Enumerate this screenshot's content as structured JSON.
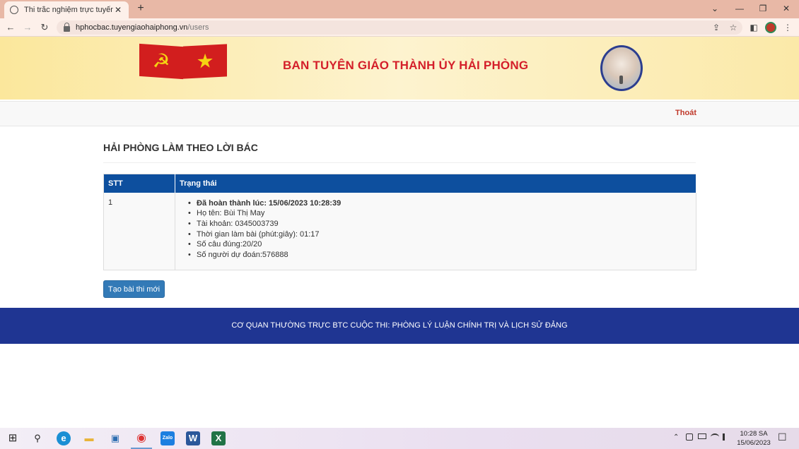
{
  "browser": {
    "tab_title": "Thi trắc nghiệm trực tuyến -",
    "tab_close": "✕",
    "new_tab": "+",
    "url_host": "hphocbac.tuyengiaohaiphong.vn",
    "url_path": "/users",
    "window_controls": {
      "tabs_menu": "⌄",
      "minimize": "—",
      "restore": "❐",
      "close": "✕"
    },
    "nav": {
      "back": "←",
      "forward": "→",
      "reload": "↻"
    },
    "toolbar_icons": {
      "share": "⇪",
      "bookmark": "☆",
      "sidebar": "◧",
      "menu": "⋮"
    }
  },
  "banner": {
    "title": "BAN TUYÊN GIÁO THÀNH ỦY HẢI PHÒNG",
    "cpv_symbol": "☭",
    "vn_star": "★"
  },
  "navbar": {
    "logout_label": "Thoát"
  },
  "main": {
    "page_title": "HẢI PHÒNG LÀM THEO LỜI BÁC",
    "table": {
      "headers": [
        "STT",
        "Trạng thái"
      ],
      "rows": [
        {
          "stt": "1",
          "status": [
            "Đã hoàn thành lúc: 15/06/2023 10:28:39",
            "Họ tên: Bùi Thị May",
            "Tài khoản: 0345003739",
            "Thời gian làm bài (phút:giây): 01:17",
            "Số câu đúng:20/20",
            "Số người dự đoán:576888"
          ]
        }
      ]
    },
    "create_button_label": "Tạo bài thi mới"
  },
  "footer": {
    "text": "CƠ QUAN THƯỜNG TRỰC BTC CUỘC THI: PHÒNG LÝ LUẬN CHÍNH TRỊ VÀ LỊCH SỬ ĐẢNG"
  },
  "taskbar": {
    "start": "⊞",
    "search": "⚲",
    "time": "10:28 SA",
    "date": "15/06/2023",
    "apps": {
      "edge": "e",
      "explorer": "▬",
      "store": "▣",
      "chrome": "◉",
      "zalo": "Zalo",
      "word": "W",
      "excel": "X"
    },
    "tray": {
      "chevron": "⌃",
      "notifications": "☐"
    }
  },
  "colors": {
    "tab_bar": "#e8b8a6",
    "banner_title": "#d41f2a",
    "table_header": "#0d4f9e",
    "button": "#337ab7",
    "footer": "#1f3592",
    "logout": "#c0392b"
  }
}
